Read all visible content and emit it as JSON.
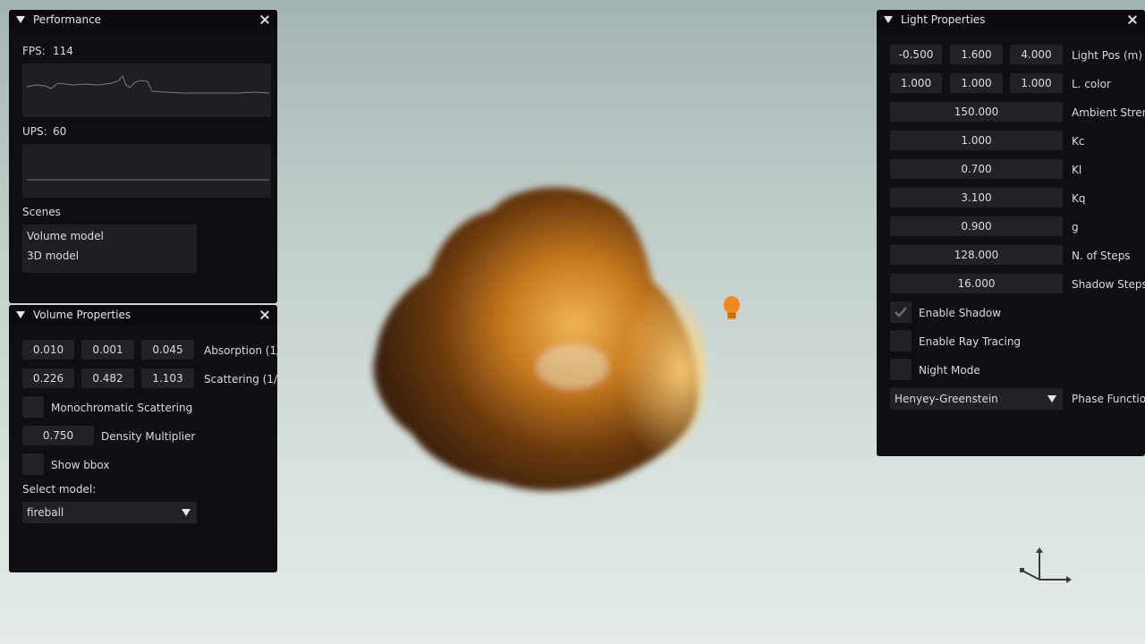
{
  "performance": {
    "title": "Performance",
    "fps_label": "FPS:",
    "fps_value": "114",
    "ups_label": "UPS:",
    "ups_value": "60",
    "scenes_label": "Scenes",
    "scenes": [
      "Volume model",
      "3D model"
    ]
  },
  "volume": {
    "title": "Volume Properties",
    "absorption": [
      "0.010",
      "0.001",
      "0.045"
    ],
    "absorption_label": "Absorption (1/",
    "scattering": [
      "0.226",
      "0.482",
      "1.103"
    ],
    "scattering_label": "Scattering (1/",
    "mono_label": "Monochromatic Scattering",
    "mono_checked": false,
    "density_value": "0.750",
    "density_label": "Density Multiplier",
    "bbox_label": "Show bbox",
    "bbox_checked": false,
    "select_label": "Select model:",
    "model": "fireball"
  },
  "light": {
    "title": "Light Properties",
    "pos": [
      "-0.500",
      "1.600",
      "4.000"
    ],
    "pos_label": "Light Pos (m)",
    "color": [
      "1.000",
      "1.000",
      "1.000"
    ],
    "color_label": "L. color",
    "ambient_value": "150.000",
    "ambient_label": "Ambient Stren",
    "kc_value": "1.000",
    "kc_label": "Kc",
    "kl_value": "0.700",
    "kl_label": "Kl",
    "kq_value": "3.100",
    "kq_label": "Kq",
    "g_value": "0.900",
    "g_label": "g",
    "steps_value": "128.000",
    "steps_label": "N. of Steps",
    "shadow_steps_value": "16.000",
    "shadow_steps_label": "Shadow Steps",
    "enable_shadow_label": "Enable Shadow",
    "enable_shadow_checked": true,
    "ray_tracing_label": "Enable Ray Tracing",
    "ray_tracing_checked": false,
    "night_mode_label": "Night Mode",
    "night_mode_checked": false,
    "phase_value": "Henyey-Greenstein",
    "phase_label": "Phase Functio"
  },
  "colors": {
    "panel_bg": "#0f0e12",
    "field_bg": "#222127",
    "accent_bulb": "#f08a1c"
  },
  "icons": [
    "collapse-triangle-icon",
    "close-icon",
    "checkmark-icon",
    "dropdown-arrow-icon",
    "light-bulb-icon",
    "axis-gizmo-icon"
  ]
}
